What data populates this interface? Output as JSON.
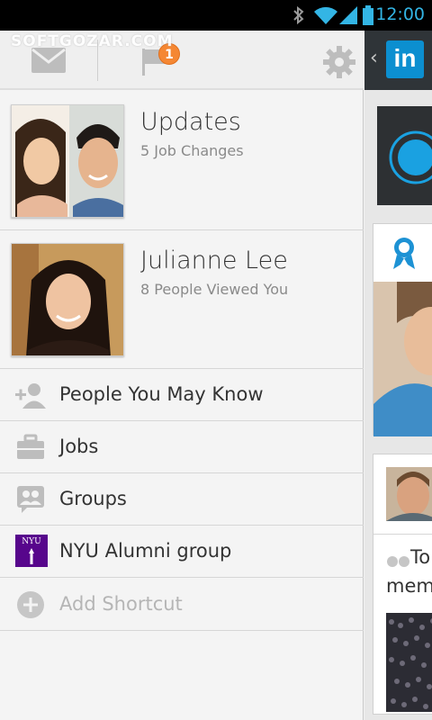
{
  "status_bar": {
    "time": "12:00",
    "icons": [
      "bluetooth-icon",
      "wifi-icon",
      "signal-icon",
      "battery-icon"
    ],
    "accent": "#33b5e5"
  },
  "drawer": {
    "watermark": "SOFTGOZAR.COM",
    "header_icons": [
      "mail-icon",
      "notifications-flag-icon",
      "settings-gear-icon"
    ],
    "notification_count": "1",
    "badge_color": "#f58733",
    "updates": {
      "title": "Updates",
      "subtitle": "5 Job Changes"
    },
    "profile": {
      "name": "Julianne Lee",
      "subtitle": "8 People Viewed You"
    },
    "menu": [
      {
        "label": "People You May Know",
        "icon": "add-person-icon"
      },
      {
        "label": "Jobs",
        "icon": "briefcase-icon"
      },
      {
        "label": "Groups",
        "icon": "groups-icon"
      },
      {
        "label": "NYU Alumni group",
        "icon": "nyu-logo-icon"
      },
      {
        "label": "Add Shortcut",
        "icon": "add-circle-icon"
      }
    ],
    "nyu_badge": "NYU",
    "nyu_color": "#57068c"
  },
  "feed": {
    "logo": "in",
    "chevron": "‹",
    "brand_color": "#0c8fd0",
    "quote_start": "To",
    "quote_line2": "mem"
  }
}
